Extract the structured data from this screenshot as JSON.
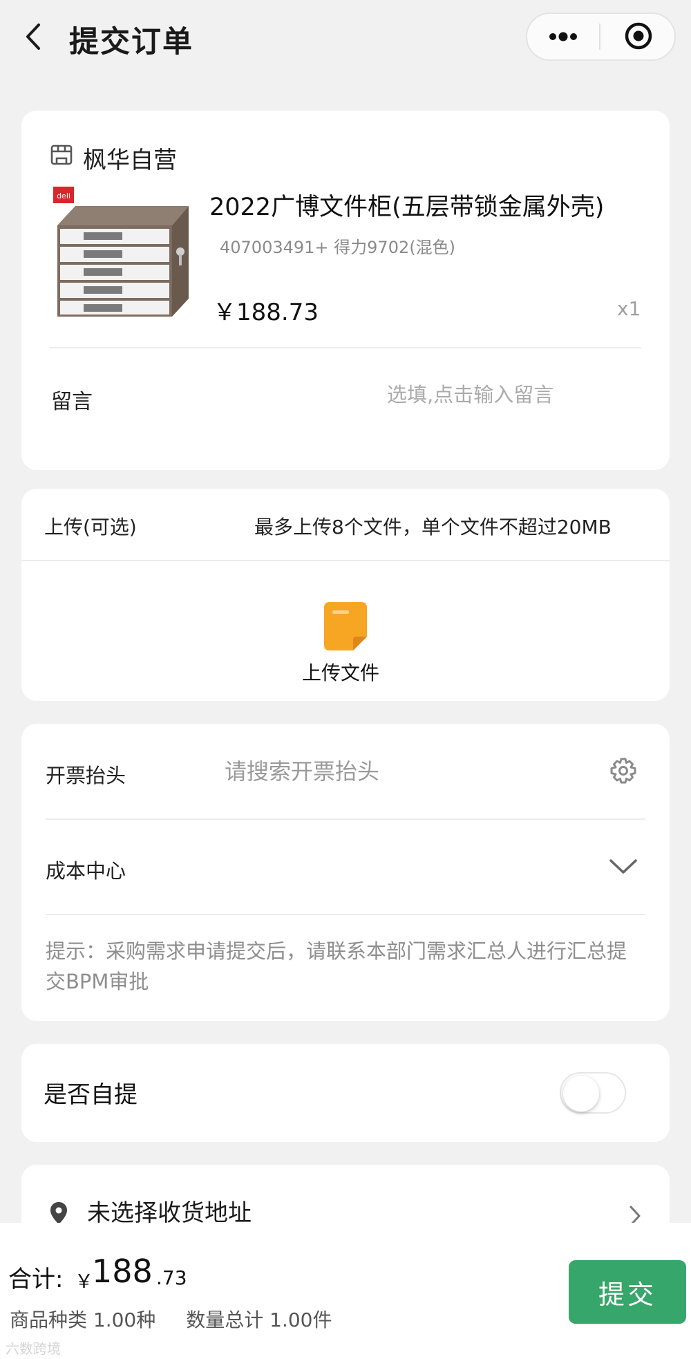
{
  "header": {
    "title": "提交订单",
    "back_icon": "chevron-left-icon",
    "more_icon": "dots-icon",
    "close_icon": "target-icon"
  },
  "order": {
    "store_name": "枫华自营",
    "store_icon": "store-icon",
    "product_title": "2022广博文件柜(五层带锁金属外壳)",
    "product_spec": "407003491+ 得力9702(混色)",
    "price": "￥188.73",
    "quantity": "x1",
    "product_brand_badge": "deli",
    "message_label": "留言",
    "message_placeholder": "选填,点击输入留言"
  },
  "upload": {
    "label": "上传(可选)",
    "hint": "最多上传8个文件，单个文件不超过20MB",
    "button_label": "上传文件"
  },
  "invoice": {
    "title_label": "开票抬头",
    "title_placeholder": "请搜索开票抬头",
    "cost_center_label": "成本中心",
    "tip": "提示：采购需求申请提交后，请联系本部门需求汇总人进行汇总提交BPM审批"
  },
  "self_pickup": {
    "label": "是否自提",
    "enabled": false
  },
  "address": {
    "text": "未选择收货地址"
  },
  "footer": {
    "total_label": "合计:",
    "currency": "￥",
    "total_int": "188",
    "total_dec": ".73",
    "kinds": "商品种类 1.00种",
    "quantity_total": "数量总计 1.00件",
    "submit_label": "提交"
  },
  "watermark": "六数跨境",
  "colors": {
    "accent": "#37a66b",
    "file_icon": "#f6a623",
    "brand_badge": "#d7272b"
  }
}
